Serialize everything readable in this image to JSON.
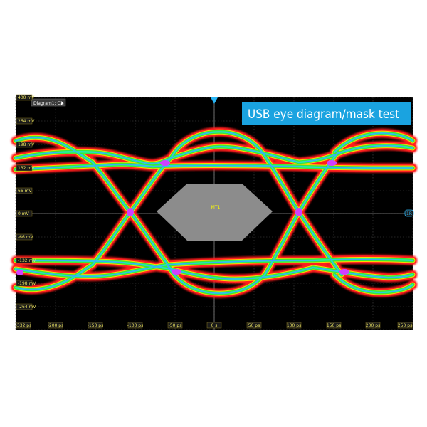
{
  "tab": {
    "label": "Diagram1: C1",
    "close": "✖"
  },
  "banner": {
    "title": "USB eye diagram/mask test"
  },
  "y_ticks": [
    "400 mV",
    "264 mV",
    "198 mV",
    "132 mV",
    "66 mV",
    "0 mV",
    "-66 mV",
    "-132 mV",
    "-198 mV",
    "-264 mV"
  ],
  "x_ticks": [
    "-332 ps",
    "-200 ps",
    "-150 ps",
    "-100 ps",
    "-50 ps",
    "0 s",
    "50 ps",
    "100 ps",
    "150 ps",
    "200 ps",
    "250 ps"
  ],
  "mask": {
    "label": "MT1"
  },
  "marker_right": "1R",
  "colors": {
    "banner_bg": "#1aa3e0",
    "grid": "#5a5a5a",
    "background": "#000000",
    "mask": "#8a8a8a",
    "trigger": "#29b6f6"
  }
}
